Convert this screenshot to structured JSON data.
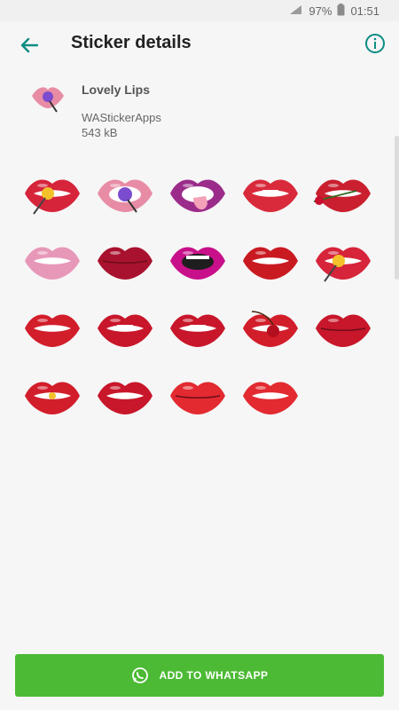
{
  "status": {
    "battery": "97%",
    "time": "01:51"
  },
  "header": {
    "title": "Sticker details"
  },
  "pack": {
    "name": "Lovely Lips",
    "publisher": "WAStickerApps",
    "size": "543 kB"
  },
  "stickers": [
    {
      "variant": "lollipop",
      "lip": "#d6243b",
      "inner": "#ffffff",
      "accent": "#f3c12a"
    },
    {
      "variant": "candy",
      "lip": "#e88ca5",
      "inner": "#ffffff",
      "accent": "#7b4ccf"
    },
    {
      "variant": "tongue",
      "lip": "#9b2c8a",
      "inner": "#ffffff",
      "accent": "#f4a0b8"
    },
    {
      "variant": "bite",
      "lip": "#d92a3b",
      "inner": "#ffffff",
      "accent": "#ffffff"
    },
    {
      "variant": "rose",
      "lip": "#c91f2f",
      "inner": "#ffffff",
      "accent": "#c8102e"
    },
    {
      "variant": "smile",
      "lip": "#e798b8",
      "inner": "#ffffff",
      "accent": "#ffffff"
    },
    {
      "variant": "closed",
      "lip": "#a9122e",
      "inner": "#ffffff",
      "accent": "#ffffff"
    },
    {
      "variant": "open",
      "lip": "#c8108a",
      "inner": "#1e1e1e",
      "accent": "#ffffff"
    },
    {
      "variant": "teeth",
      "lip": "#c91a22",
      "inner": "#ffffff",
      "accent": "#ffffff"
    },
    {
      "variant": "lollipop",
      "lip": "#d6243b",
      "inner": "#ffffff",
      "accent": "#f3c12a"
    },
    {
      "variant": "teeth",
      "lip": "#d21d2b",
      "inner": "#ffffff",
      "accent": "#ffffff"
    },
    {
      "variant": "bite",
      "lip": "#c8162a",
      "inner": "#ffffff",
      "accent": "#ffffff"
    },
    {
      "variant": "bite",
      "lip": "#c8162a",
      "inner": "#ffffff",
      "accent": "#ffffff"
    },
    {
      "variant": "cherry",
      "lip": "#d21d2b",
      "inner": "#ffffff",
      "accent": "#b40f1e"
    },
    {
      "variant": "closed",
      "lip": "#c8162a",
      "inner": "#ffffff",
      "accent": "#ffffff"
    },
    {
      "variant": "pill",
      "lip": "#d21d2b",
      "inner": "#ffffff",
      "accent": "#f3c12a"
    },
    {
      "variant": "teeth",
      "lip": "#c8162a",
      "inner": "#ffffff",
      "accent": "#ffffff"
    },
    {
      "variant": "kiss",
      "lip": "#e22a30",
      "inner": "#ffffff",
      "accent": "#ffffff"
    },
    {
      "variant": "teeth",
      "lip": "#e22a30",
      "inner": "#ffffff",
      "accent": "#ffffff"
    }
  ],
  "button": {
    "label": "ADD TO WHATSAPP"
  },
  "colors": {
    "accent": "#0c8c83",
    "button": "#4cba34"
  }
}
